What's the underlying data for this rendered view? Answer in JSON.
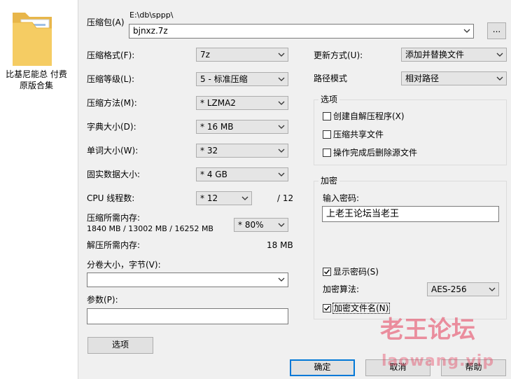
{
  "desktop": {
    "icon_label_line1": "比基尼能总 付费",
    "icon_label_line2": "原版合集"
  },
  "archive": {
    "label": "压缩包(A)",
    "path_prefix": "E:\\db\\sppp\\",
    "name": "bjnxz.7z",
    "browse_label": "..."
  },
  "left": {
    "format_label": "压缩格式(F):",
    "format_value": "7z",
    "level_label": "压缩等级(L):",
    "level_value": "5 - 标准压缩",
    "method_label": "压缩方法(M):",
    "method_value": "* LZMA2",
    "dict_label": "字典大小(D):",
    "dict_value": "* 16 MB",
    "word_label": "单词大小(W):",
    "word_value": "* 32",
    "solid_label": "固实数据大小:",
    "solid_value": "* 4 GB",
    "threads_label": "CPU 线程数:",
    "threads_value": "* 12",
    "threads_max": "/ 12",
    "mem_comp_label": "压缩所需内存:",
    "mem_comp_value": "1840 MB / 13002 MB / 16252 MB",
    "mem_pct_value": "* 80%",
    "mem_decomp_label": "解压所需内存:",
    "mem_decomp_value": "18 MB",
    "split_label": "分卷大小，字节(V):",
    "split_value": "",
    "params_label": "参数(P):",
    "params_value": "",
    "options_button": "选项"
  },
  "right": {
    "update_label": "更新方式(U):",
    "update_value": "添加并替换文件",
    "path_label": "路径模式",
    "path_value": "相对路径",
    "options_group": "选项",
    "opt_sfx": "创建自解压程序(X)",
    "opt_shared": "压缩共享文件",
    "opt_delete": "操作完成后删除源文件",
    "enc_group": "加密",
    "password_label": "输入密码:",
    "password_value": "上老王论坛当老王",
    "show_password": "显示密码(S)",
    "enc_method_label": "加密算法:",
    "enc_method_value": "AES-256",
    "encrypt_names": "加密文件名(N)"
  },
  "buttons": {
    "ok": "确定",
    "cancel": "取消",
    "help": "帮助"
  },
  "checks": {
    "sfx": false,
    "shared": false,
    "delete": false,
    "show_password": true,
    "encrypt_names": true
  },
  "watermark": {
    "cn": "老王论坛",
    "url": "laowang.vip"
  }
}
